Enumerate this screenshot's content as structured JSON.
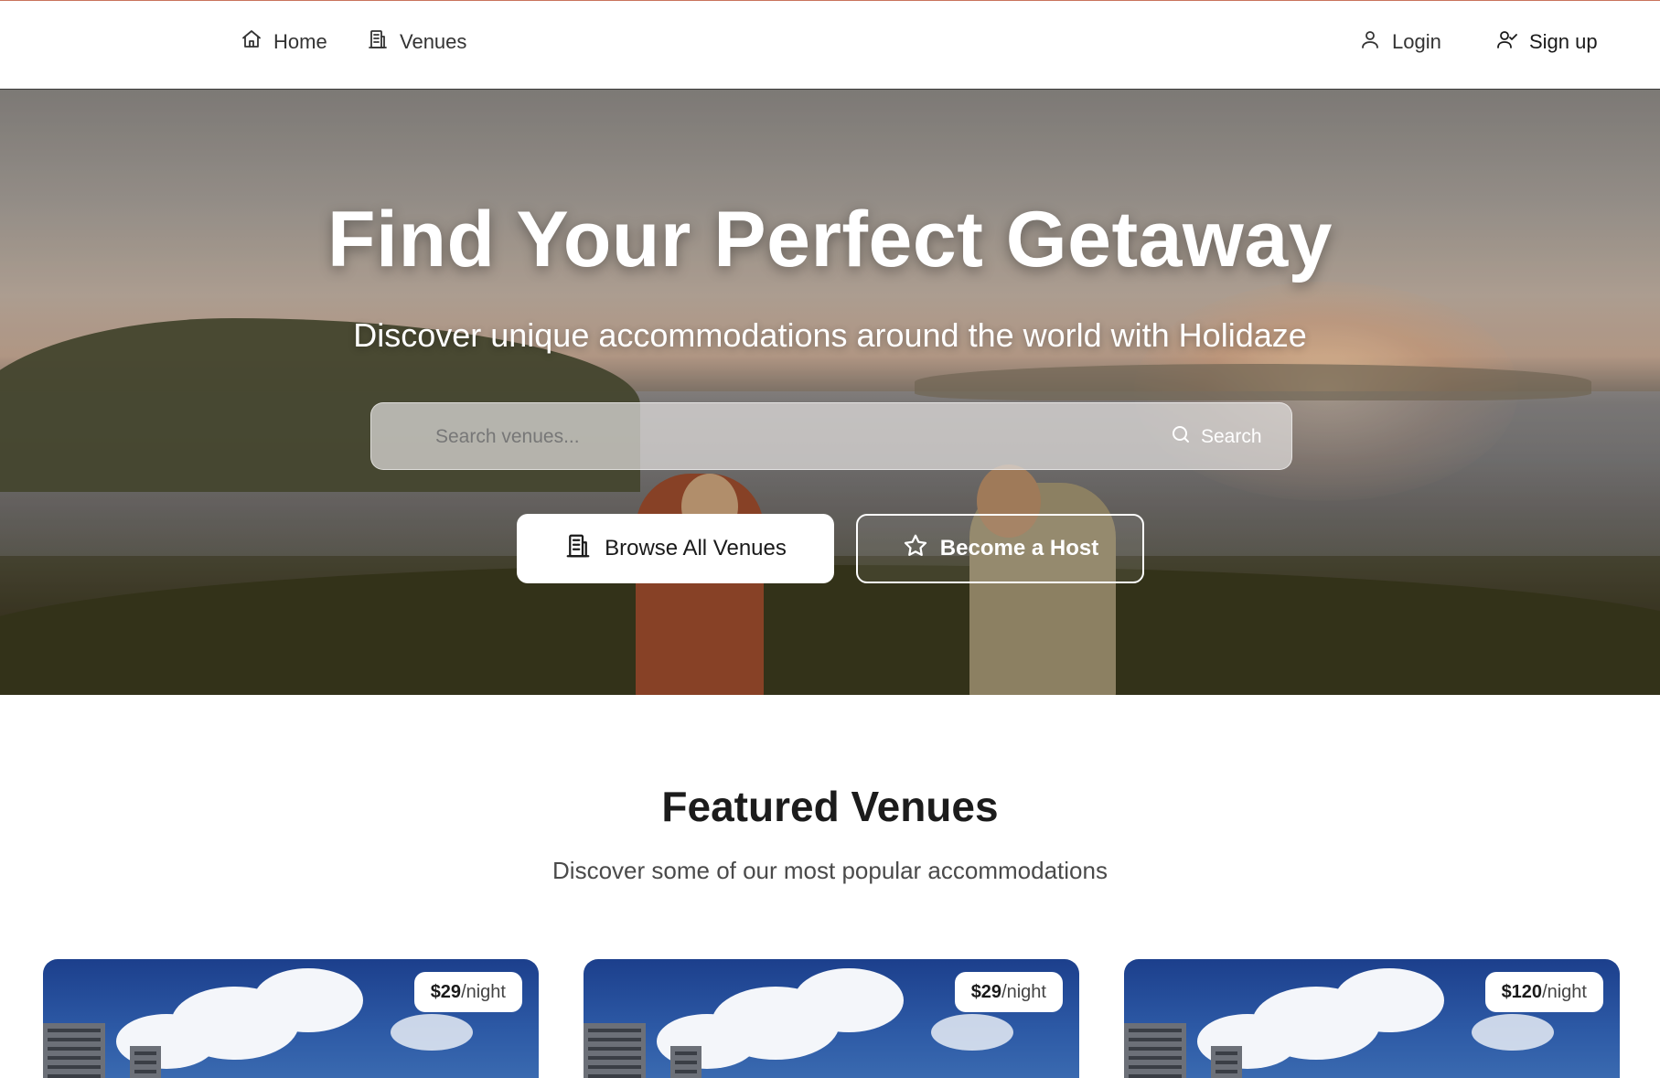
{
  "nav": {
    "home_label": "Home",
    "venues_label": "Venues",
    "login_label": "Login",
    "signup_label": "Sign up"
  },
  "hero": {
    "title": "Find Your Perfect Getaway",
    "subtitle": "Discover unique accommodations around the world with Holidaze",
    "search": {
      "placeholder": "Search venues...",
      "value": "",
      "button_label": "Search"
    },
    "browse_button_label": "Browse All Venues",
    "host_button_label": "Become a Host"
  },
  "featured": {
    "title": "Featured Venues",
    "subtitle": "Discover some of our most popular accommodations",
    "venues": [
      {
        "price": "$29",
        "unit": "/night"
      },
      {
        "price": "$29",
        "unit": "/night"
      },
      {
        "price": "$120",
        "unit": "/night"
      }
    ]
  },
  "icons": {
    "home": "home-icon",
    "venues": "building-icon",
    "login": "user-icon",
    "signup": "user-check-icon",
    "search": "search-icon",
    "browse": "building-icon",
    "host": "star-icon"
  },
  "colors": {
    "nav_top_accent": "#c9745c",
    "text_dark": "#1a1a1a",
    "white": "#ffffff"
  }
}
